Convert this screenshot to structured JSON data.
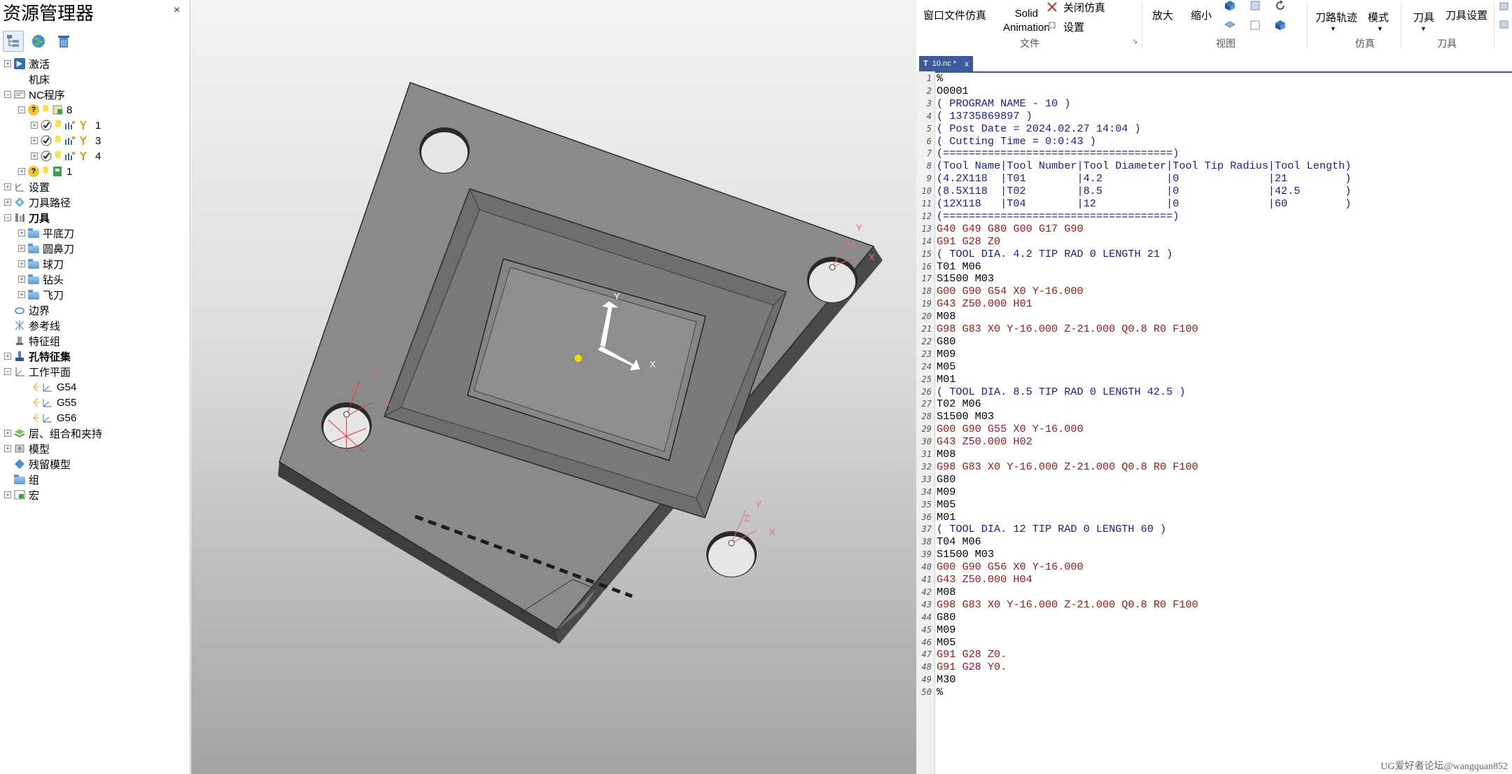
{
  "explorer": {
    "title": "资源管理器",
    "close": "×",
    "tree": [
      {
        "label": "激活"
      },
      {
        "label": "机床"
      },
      {
        "label": "NC程序"
      },
      {
        "label": "8"
      },
      {
        "label": "1"
      },
      {
        "label": "3"
      },
      {
        "label": "4"
      },
      {
        "label": "1"
      },
      {
        "label": "设置"
      },
      {
        "label": "刀具路径"
      },
      {
        "label": "刀具"
      },
      {
        "label": "平底刀"
      },
      {
        "label": "圆鼻刀"
      },
      {
        "label": "球刀"
      },
      {
        "label": "钻头"
      },
      {
        "label": "飞刀"
      },
      {
        "label": "边界"
      },
      {
        "label": "参考线"
      },
      {
        "label": "特征组"
      },
      {
        "label": "孔特征集"
      },
      {
        "label": "工作平面"
      },
      {
        "label": "G54"
      },
      {
        "label": "G55"
      },
      {
        "label": "G56"
      },
      {
        "label": "层、组合和夹持"
      },
      {
        "label": "模型"
      },
      {
        "label": "残留模型"
      },
      {
        "label": "组"
      },
      {
        "label": "宏"
      }
    ]
  },
  "ribbon": {
    "window_sim": "窗口文件仿真",
    "solid_animation_1": "Solid",
    "solid_animation_2": "Animation",
    "close_sim": "关闭仿真",
    "settings": "设置",
    "group_file": "文件",
    "zoom_in": "放大",
    "zoom_out": "缩小",
    "group_view": "视图",
    "toolpath": "刀路轨迹",
    "mode": "模式",
    "group_sim": "仿真",
    "tool": "刀具",
    "tool_settings": "刀具设置",
    "group_tool": "刀具"
  },
  "viewport": {
    "axis_x": "X",
    "axis_y": "Y",
    "axis_z": "Z"
  },
  "editor": {
    "tab_label": "10.nc *",
    "tab_close": "x",
    "lines": [
      {
        "n": "1",
        "text": "%",
        "c": "blk"
      },
      {
        "n": "2",
        "text": "O0001",
        "c": "blk"
      },
      {
        "n": "3",
        "text": "( PROGRAM NAME - 10 )",
        "c": "blu"
      },
      {
        "n": "4",
        "text": "( 13735869897 )",
        "c": "blu"
      },
      {
        "n": "5",
        "text": "( Post Date = 2024.02.27 14:04 )",
        "c": "blu"
      },
      {
        "n": "6",
        "text": "( Cutting Time = 0:0:43 )",
        "c": "blu"
      },
      {
        "n": "7",
        "text": "(====================================)",
        "c": "blu"
      },
      {
        "n": "8",
        "text": "(Tool Name|Tool Number|Tool Diameter|Tool Tip Radius|Tool Length)",
        "c": "blu"
      },
      {
        "n": "9",
        "text": "(4.2X118  |T01        |4.2          |0              |21         )",
        "c": "blu"
      },
      {
        "n": "10",
        "text": "(8.5X118  |T02        |8.5          |0              |42.5       )",
        "c": "blu"
      },
      {
        "n": "11",
        "text": "(12X118   |T04        |12           |0              |60         )",
        "c": "blu"
      },
      {
        "n": "12",
        "text": "(====================================)",
        "c": "blu"
      },
      {
        "n": "13",
        "text": "G40 G49 G80 G00 G17 G90",
        "c": "red"
      },
      {
        "n": "14",
        "text": "G91 G28 Z0",
        "c": "red"
      },
      {
        "n": "15",
        "text": "( TOOL DIA. 4.2 TIP RAD 0 LENGTH 21 )",
        "c": "blu"
      },
      {
        "n": "16",
        "text": "T01 M06",
        "c": "blk"
      },
      {
        "n": "17",
        "text": "S1500 M03",
        "c": "blk"
      },
      {
        "n": "18",
        "text": "G00 G90 G54 X0 Y-16.000",
        "c": "red"
      },
      {
        "n": "19",
        "text": "G43 Z50.000 H01",
        "c": "red"
      },
      {
        "n": "20",
        "text": "M08",
        "c": "blk"
      },
      {
        "n": "21",
        "text": "G98 G83 X0 Y-16.000 Z-21.000 Q0.8 R0 F100",
        "c": "red"
      },
      {
        "n": "22",
        "text": "G80",
        "c": "blk"
      },
      {
        "n": "23",
        "text": "M09",
        "c": "blk"
      },
      {
        "n": "24",
        "text": "M05",
        "c": "blk"
      },
      {
        "n": "25",
        "text": "M01",
        "c": "blk"
      },
      {
        "n": "26",
        "text": "( TOOL DIA. 8.5 TIP RAD 0 LENGTH 42.5 )",
        "c": "blu"
      },
      {
        "n": "27",
        "text": "T02 M06",
        "c": "blk"
      },
      {
        "n": "28",
        "text": "S1500 M03",
        "c": "blk"
      },
      {
        "n": "29",
        "text": "G00 G90 G55 X0 Y-16.000",
        "c": "red"
      },
      {
        "n": "30",
        "text": "G43 Z50.000 H02",
        "c": "red"
      },
      {
        "n": "31",
        "text": "M08",
        "c": "blk"
      },
      {
        "n": "32",
        "text": "G98 G83 X0 Y-16.000 Z-21.000 Q0.8 R0 F100",
        "c": "red"
      },
      {
        "n": "33",
        "text": "G80",
        "c": "blk"
      },
      {
        "n": "34",
        "text": "M09",
        "c": "blk"
      },
      {
        "n": "35",
        "text": "M05",
        "c": "blk"
      },
      {
        "n": "36",
        "text": "M01",
        "c": "blk"
      },
      {
        "n": "37",
        "text": "( TOOL DIA. 12 TIP RAD 0 LENGTH 60 )",
        "c": "blu"
      },
      {
        "n": "38",
        "text": "T04 M06",
        "c": "blk"
      },
      {
        "n": "39",
        "text": "S1500 M03",
        "c": "blk"
      },
      {
        "n": "40",
        "text": "G00 G90 G56 X0 Y-16.000",
        "c": "red"
      },
      {
        "n": "41",
        "text": "G43 Z50.000 H04",
        "c": "red"
      },
      {
        "n": "42",
        "text": "M08",
        "c": "blk"
      },
      {
        "n": "43",
        "text": "G98 G83 X0 Y-16.000 Z-21.000 Q0.8 R0 F100",
        "c": "red"
      },
      {
        "n": "44",
        "text": "G80",
        "c": "blk"
      },
      {
        "n": "45",
        "text": "M09",
        "c": "blk"
      },
      {
        "n": "46",
        "text": "M05",
        "c": "blk"
      },
      {
        "n": "47",
        "text": "G91 G28 Z0.",
        "c": "red"
      },
      {
        "n": "48",
        "text": "G91 G28 Y0.",
        "c": "red"
      },
      {
        "n": "49",
        "text": "M30",
        "c": "blk"
      },
      {
        "n": "50",
        "text": "%",
        "c": "blk"
      }
    ]
  },
  "watermark": "UG爱好者论坛@wangquan852",
  "colors": {
    "code_black": "#000000",
    "code_red": "#a01818",
    "code_blue": "#1a1a9a",
    "tab_blue": "#3c5b9c",
    "axis_red": "#e03030"
  }
}
